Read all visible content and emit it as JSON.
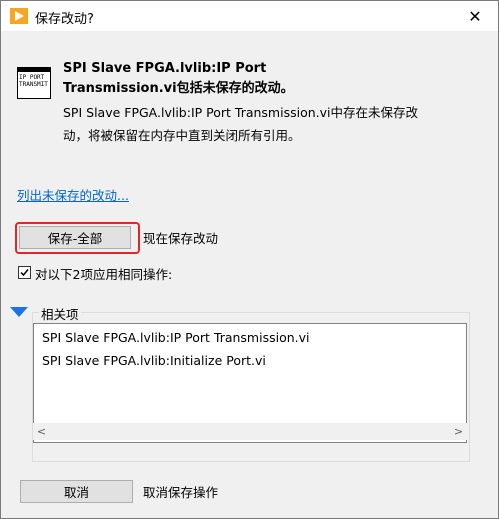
{
  "window": {
    "title": "保存改动?"
  },
  "icons": {
    "app": "labview-app-icon",
    "close": "close-icon",
    "vi": "vi-file-icon"
  },
  "vi_icon": {
    "line1": "IP PORT",
    "line2": "TRANSMIT"
  },
  "message": {
    "bold": "SPI Slave FPGA.lvlib:IP Port Transmission.vi包括未保存的改动。",
    "body": "SPI Slave FPGA.lvlib:IP Port Transmission.vi中存在未保存改动，将被保留在内存中直到关闭所有引用。"
  },
  "list_changes_link": "列出未保存的改动...",
  "save_all": {
    "label": "保存-全部",
    "description": "现在保存改动"
  },
  "apply_all": {
    "checked": true,
    "label": "对以下2项应用相同操作:"
  },
  "related": {
    "title": "相关项",
    "items": [
      "SPI Slave FPGA.lvlib:IP Port Transmission.vi",
      "SPI Slave FPGA.lvlib:Initialize Port.vi"
    ]
  },
  "cancel": {
    "label": "取消",
    "description": "取消保存操作"
  },
  "colors": {
    "highlight": "#e3262b",
    "link": "#0066cc",
    "app_icon": "#f5a623"
  }
}
